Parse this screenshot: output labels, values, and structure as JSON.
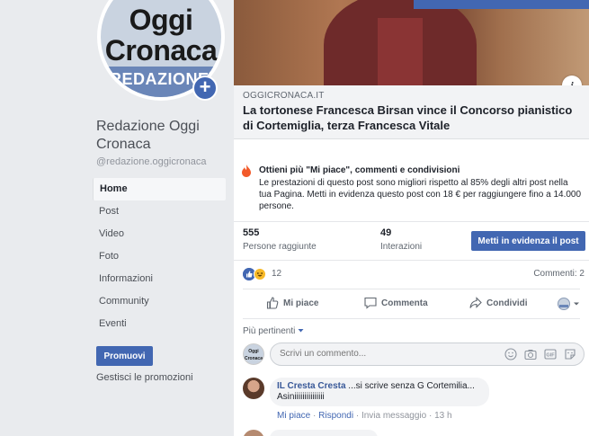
{
  "sidebar": {
    "avatar": {
      "line1": "Oggi",
      "line2": "Cronaca",
      "band_text": "REDAZIONE",
      "plus": "+"
    },
    "page_name": "Redazione Oggi Cronaca",
    "handle": "@redazione.oggicronaca",
    "nav": [
      "Home",
      "Post",
      "Video",
      "Foto",
      "Informazioni",
      "Community",
      "Eventi"
    ],
    "promote_label": "Promuovi",
    "manage_label": "Gestisci le promozioni"
  },
  "post": {
    "info_icon": "i",
    "link": {
      "domain": "OGGICRONACA.IT",
      "title": "La tortonese Francesca Birsan vince il Concorso pianistico di Cortemiglia, terza Francesca Vitale"
    },
    "boost": {
      "headline": "Ottieni più \"Mi piace\", commenti e condivisioni",
      "body": "Le prestazioni di questo post sono migliori rispetto al 85% degli altri post nella tua Pagina. Metti in evidenza questo post con 18 € per raggiungere fino a 14.000 persone."
    },
    "stats": {
      "reach_value": "555",
      "reach_label": "Persone raggiunte",
      "interactions_value": "49",
      "interactions_label": "Interazioni",
      "boost_button": "Metti in evidenza il post"
    },
    "reactions": {
      "count": "12",
      "comments": "Commenti: 2"
    },
    "actions": {
      "like": "Mi piace",
      "comment": "Commenta",
      "share": "Condividi"
    },
    "sort_label": "Più pertinenti",
    "composer": {
      "avatar_text": "Oggi Cronaca",
      "placeholder": "Scrivi un commento..."
    },
    "comments": [
      {
        "author": "IL Cresta Cresta",
        "text": " ...si scrive senza G Cortemilia... Asiniiiiiiiiiiiiiii",
        "like": "Mi piace",
        "reply": "Rispondi",
        "message": "Invia messaggio",
        "time": "13 h"
      }
    ]
  },
  "colors": {
    "brand": "#4267b2",
    "link": "#385898",
    "background": "#e9ebee"
  }
}
